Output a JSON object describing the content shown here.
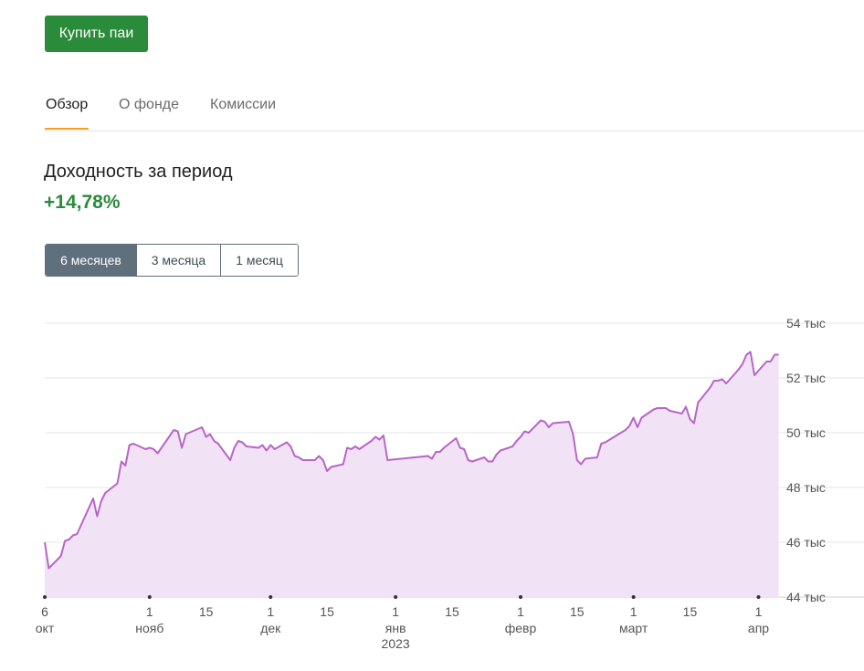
{
  "buy_button": {
    "label": "Купить паи"
  },
  "tabs": [
    {
      "label": "Обзор",
      "active": true
    },
    {
      "label": "О фонде",
      "active": false
    },
    {
      "label": "Комиссии",
      "active": false
    }
  ],
  "performance": {
    "title": "Доходность за период",
    "value": "+14,78%"
  },
  "periods": [
    {
      "label": "6 месяцев",
      "active": true
    },
    {
      "label": "3 месяца",
      "active": false
    },
    {
      "label": "1 месяц",
      "active": false
    }
  ],
  "colors": {
    "accent_green": "#2a8b3a",
    "tab_underline": "#f2a024",
    "line": "#b766c8",
    "area": "#f1e2f5",
    "period_active": "#5f6f7b"
  },
  "chart_data": {
    "type": "area",
    "title": "",
    "xlabel": "",
    "ylabel": "",
    "ylim": [
      44000,
      54000
    ],
    "y_ticks": [
      {
        "value": 54000,
        "label": "54 тыс"
      },
      {
        "value": 52000,
        "label": "52 тыс"
      },
      {
        "value": 50000,
        "label": "50 тыс"
      },
      {
        "value": 48000,
        "label": "48 тыс"
      },
      {
        "value": 46000,
        "label": "46 тыс"
      },
      {
        "value": 44000,
        "label": "44 тыс"
      }
    ],
    "x_range": [
      "2022-10-06",
      "2023-04-07"
    ],
    "x_ticks": [
      {
        "date": "2022-10-06",
        "label": "6",
        "sublabel": "окт",
        "dot": true
      },
      {
        "date": "2022-11-01",
        "label": "1",
        "sublabel": "нояб",
        "dot": true
      },
      {
        "date": "2022-11-15",
        "label": "15",
        "sublabel": "",
        "dot": false
      },
      {
        "date": "2022-12-01",
        "label": "1",
        "sublabel": "дек",
        "dot": true
      },
      {
        "date": "2022-12-15",
        "label": "15",
        "sublabel": "",
        "dot": false
      },
      {
        "date": "2023-01-01",
        "label": "1",
        "sublabel": "янв",
        "sublabel2": "2023",
        "dot": true
      },
      {
        "date": "2023-01-15",
        "label": "15",
        "sublabel": "",
        "dot": false
      },
      {
        "date": "2023-02-01",
        "label": "1",
        "sublabel": "февр",
        "dot": true
      },
      {
        "date": "2023-02-15",
        "label": "15",
        "sublabel": "",
        "dot": false
      },
      {
        "date": "2023-03-01",
        "label": "1",
        "sublabel": "март",
        "dot": true
      },
      {
        "date": "2023-03-15",
        "label": "15",
        "sublabel": "",
        "dot": false
      },
      {
        "date": "2023-04-01",
        "label": "1",
        "sublabel": "апр",
        "dot": true
      }
    ],
    "series": [
      {
        "points": [
          [
            "2022-10-06",
            46000
          ],
          [
            "2022-10-07",
            45050
          ],
          [
            "2022-10-10",
            45500
          ],
          [
            "2022-10-11",
            46050
          ],
          [
            "2022-10-12",
            46100
          ],
          [
            "2022-10-13",
            46250
          ],
          [
            "2022-10-14",
            46300
          ],
          [
            "2022-10-18",
            47600
          ],
          [
            "2022-10-19",
            46950
          ],
          [
            "2022-10-20",
            47500
          ],
          [
            "2022-10-21",
            47800
          ],
          [
            "2022-10-24",
            48150
          ],
          [
            "2022-10-25",
            48950
          ],
          [
            "2022-10-26",
            48800
          ],
          [
            "2022-10-27",
            49550
          ],
          [
            "2022-10-28",
            49600
          ],
          [
            "2022-10-31",
            49400
          ],
          [
            "2022-11-01",
            49450
          ],
          [
            "2022-11-02",
            49400
          ],
          [
            "2022-11-03",
            49250
          ],
          [
            "2022-11-07",
            50100
          ],
          [
            "2022-11-08",
            50050
          ],
          [
            "2022-11-09",
            49450
          ],
          [
            "2022-11-10",
            49950
          ],
          [
            "2022-11-14",
            50200
          ],
          [
            "2022-11-15",
            49850
          ],
          [
            "2022-11-16",
            49950
          ],
          [
            "2022-11-17",
            49700
          ],
          [
            "2022-11-18",
            49600
          ],
          [
            "2022-11-21",
            49000
          ],
          [
            "2022-11-22",
            49450
          ],
          [
            "2022-11-23",
            49700
          ],
          [
            "2022-11-24",
            49650
          ],
          [
            "2022-11-25",
            49500
          ],
          [
            "2022-11-28",
            49450
          ],
          [
            "2022-11-29",
            49550
          ],
          [
            "2022-11-30",
            49350
          ],
          [
            "2022-12-01",
            49550
          ],
          [
            "2022-12-02",
            49400
          ],
          [
            "2022-12-05",
            49650
          ],
          [
            "2022-12-06",
            49500
          ],
          [
            "2022-12-07",
            49150
          ],
          [
            "2022-12-08",
            49100
          ],
          [
            "2022-12-09",
            49000
          ],
          [
            "2022-12-12",
            49000
          ],
          [
            "2022-12-13",
            49150
          ],
          [
            "2022-12-14",
            49000
          ],
          [
            "2022-12-15",
            48600
          ],
          [
            "2022-12-16",
            48750
          ],
          [
            "2022-12-19",
            48850
          ],
          [
            "2022-12-20",
            49450
          ],
          [
            "2022-12-21",
            49400
          ],
          [
            "2022-12-22",
            49500
          ],
          [
            "2022-12-23",
            49400
          ],
          [
            "2022-12-26",
            49700
          ],
          [
            "2022-12-27",
            49850
          ],
          [
            "2022-12-28",
            49750
          ],
          [
            "2022-12-29",
            49900
          ],
          [
            "2022-12-30",
            49000
          ],
          [
            "2023-01-09",
            49150
          ],
          [
            "2023-01-10",
            49050
          ],
          [
            "2023-01-11",
            49300
          ],
          [
            "2023-01-12",
            49300
          ],
          [
            "2023-01-13",
            49450
          ],
          [
            "2023-01-16",
            49800
          ],
          [
            "2023-01-17",
            49450
          ],
          [
            "2023-01-18",
            49400
          ],
          [
            "2023-01-19",
            49000
          ],
          [
            "2023-01-20",
            48950
          ],
          [
            "2023-01-23",
            49100
          ],
          [
            "2023-01-24",
            48950
          ],
          [
            "2023-01-25",
            48950
          ],
          [
            "2023-01-26",
            49200
          ],
          [
            "2023-01-27",
            49350
          ],
          [
            "2023-01-30",
            49500
          ],
          [
            "2023-01-31",
            49700
          ],
          [
            "2023-02-01",
            49850
          ],
          [
            "2023-02-02",
            50050
          ],
          [
            "2023-02-03",
            50000
          ],
          [
            "2023-02-06",
            50450
          ],
          [
            "2023-02-07",
            50400
          ],
          [
            "2023-02-08",
            50200
          ],
          [
            "2023-02-09",
            50350
          ],
          [
            "2023-02-13",
            50400
          ],
          [
            "2023-02-14",
            49950
          ],
          [
            "2023-02-15",
            49000
          ],
          [
            "2023-02-16",
            48850
          ],
          [
            "2023-02-17",
            49050
          ],
          [
            "2023-02-20",
            49100
          ],
          [
            "2023-02-21",
            49600
          ],
          [
            "2023-02-22",
            49650
          ],
          [
            "2023-02-27",
            50100
          ],
          [
            "2023-02-28",
            50250
          ],
          [
            "2023-03-01",
            50550
          ],
          [
            "2023-03-02",
            50200
          ],
          [
            "2023-03-03",
            50550
          ],
          [
            "2023-03-06",
            50850
          ],
          [
            "2023-03-07",
            50900
          ],
          [
            "2023-03-09",
            50900
          ],
          [
            "2023-03-10",
            50800
          ],
          [
            "2023-03-13",
            50700
          ],
          [
            "2023-03-14",
            50950
          ],
          [
            "2023-03-15",
            50500
          ],
          [
            "2023-03-16",
            50350
          ],
          [
            "2023-03-17",
            51100
          ],
          [
            "2023-03-20",
            51650
          ],
          [
            "2023-03-21",
            51900
          ],
          [
            "2023-03-22",
            51900
          ],
          [
            "2023-03-23",
            51950
          ],
          [
            "2023-03-24",
            51800
          ],
          [
            "2023-03-27",
            52300
          ],
          [
            "2023-03-28",
            52500
          ],
          [
            "2023-03-29",
            52850
          ],
          [
            "2023-03-30",
            52950
          ],
          [
            "2023-03-31",
            52100
          ],
          [
            "2023-04-03",
            52600
          ],
          [
            "2023-04-04",
            52600
          ],
          [
            "2023-04-05",
            52850
          ],
          [
            "2023-04-06",
            52850
          ]
        ]
      }
    ]
  }
}
